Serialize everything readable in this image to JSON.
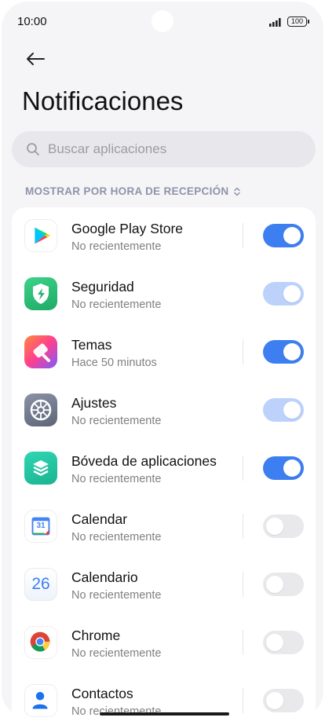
{
  "status_bar": {
    "time": "10:00",
    "battery": "100",
    "icons": [
      "camera-cutout",
      "signal-icon",
      "battery-icon"
    ]
  },
  "header": {
    "back_icon": "arrow-left-icon",
    "title": "Notificaciones"
  },
  "search": {
    "icon": "search-icon",
    "placeholder": "Buscar aplicaciones"
  },
  "sort": {
    "label": "MOSTRAR POR HORA DE RECEPCIÓN",
    "icon": "sort-updown-icon"
  },
  "colors": {
    "toggle_on": "#3d7ff0",
    "toggle_on_disabled": "#bcd2fa",
    "toggle_off": "#e9e9ec",
    "sort_label": "#8e93aa"
  },
  "apps": [
    {
      "name": "Google Play Store",
      "subtitle": "No recientemente",
      "icon": "google-play-icon",
      "toggle": "on"
    },
    {
      "name": "Seguridad",
      "subtitle": "No recientemente",
      "icon": "security-shield-icon",
      "toggle": "on-disabled"
    },
    {
      "name": "Temas",
      "subtitle": "Hace 50 minutos",
      "icon": "themes-brush-icon",
      "toggle": "on"
    },
    {
      "name": "Ajustes",
      "subtitle": "No recientemente",
      "icon": "settings-gear-icon",
      "toggle": "on-disabled"
    },
    {
      "name": "Bóveda de aplicaciones",
      "subtitle": "No recientemente",
      "icon": "app-vault-layers-icon",
      "toggle": "on"
    },
    {
      "name": "Calendar",
      "subtitle": "No recientemente",
      "icon": "google-calendar-icon",
      "calendar_day": "31",
      "toggle": "off"
    },
    {
      "name": "Calendario",
      "subtitle": "No recientemente",
      "icon": "calendar-icon",
      "calendar_day": "26",
      "toggle": "off"
    },
    {
      "name": "Chrome",
      "subtitle": "No recientemente",
      "icon": "chrome-icon",
      "toggle": "off"
    },
    {
      "name": "Contactos",
      "subtitle": "No recientemente",
      "icon": "contacts-person-icon",
      "toggle": "off"
    }
  ]
}
